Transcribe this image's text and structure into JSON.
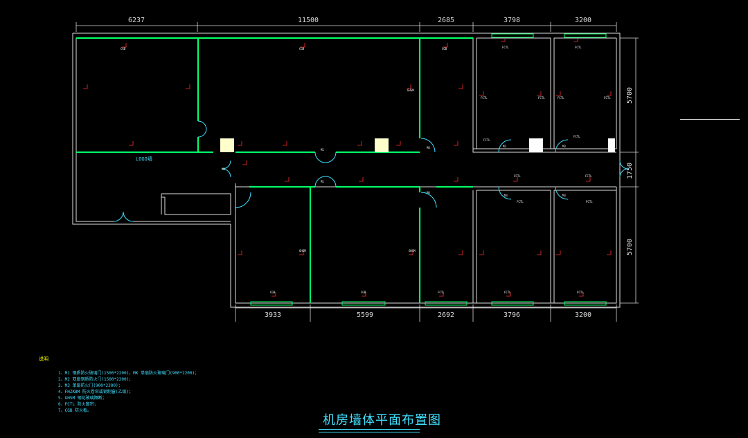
{
  "title": "机房墙体平面布置图",
  "notes_heading": "说明",
  "notes": [
    "1、M1 钢质防火玻璃门(1500*2200)，MK 单扇防火玻璃门(900*2200)；",
    "2、M2 双扇钢质防火门(1500*2200)；",
    "3、M3 单扇防火门(900*2300)；",
    "4、FHZKBM 防火卷帘或钢制窗(乙级)；",
    "5、GHSM 钢化玻璃隔断；",
    "6、FCTL 防火窗帘；",
    "7、CGB 防火板。"
  ],
  "dimensions": {
    "top": [
      "6237",
      "11500",
      "2685",
      "3798",
      "3200"
    ],
    "bottom": [
      "3933",
      "5599",
      "2692",
      "3796",
      "3200"
    ],
    "right": [
      "5700",
      "1750",
      "5700"
    ]
  },
  "labels": {
    "logo": "LOGO墙",
    "cgb": "CGB",
    "ghsm": "GHSM",
    "fctl": "FCTL",
    "m1": "M1",
    "m2": "M2",
    "m3": "M3",
    "m4": "M4"
  },
  "colors": {
    "wall": "#e0e0e0",
    "partition": "#00ff66",
    "door": "#40e0ff",
    "tag": "#ff3030",
    "window": "#00ff66"
  }
}
